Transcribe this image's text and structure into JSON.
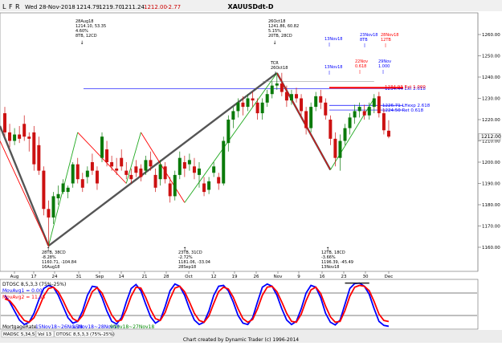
{
  "toolbar": {
    "letters": [
      "L",
      "F",
      "R"
    ],
    "date": "Wed 28-Nov-2018",
    "open": "1214.79",
    "high": "1219.70",
    "low": "1211.24",
    "close": "1212.00",
    "change": "-2.77",
    "title": "XAUUSDdt-D"
  },
  "colors": {
    "up_candle": "#0a7a0a",
    "down_candle": "#cc1111",
    "swing_line": "#555555",
    "red_line": "#ff0000",
    "green_line": "#22aa22",
    "blue_line": "#0000ff",
    "osc_fast": "#0000ff",
    "osc_slow": "#ff0000"
  },
  "chart_data": [
    {
      "type": "candlestick",
      "title": "XAUUSDdt-D",
      "y_axis_labels": [
        "1160.00",
        "1170.00",
        "1180.00",
        "1190.00",
        "1200.00",
        "1210.00",
        "1220.00",
        "1230.00",
        "1240.00",
        "1250.00",
        "1260.00"
      ],
      "x_axis_labels": [
        "Aug",
        "17",
        "24",
        "31",
        "Sep",
        "14",
        "21",
        "28",
        "Oct",
        "12",
        "19",
        "26",
        "Nov",
        "9",
        "16",
        "23",
        "30",
        "Dec"
      ],
      "ylim": [
        1155,
        1265
      ],
      "grid": false,
      "last_price_label": "1212.00",
      "price_levels": [
        {
          "label": "1234.44 Ext 2.618",
          "value": 1234.6,
          "color": "#0000ff"
        },
        {
          "label": "1234.93 Ext 1.000",
          "value": 1235.0,
          "color": "#ff0000"
        },
        {
          "label": "1226.71 LHexp 2.618",
          "value": 1226.7,
          "color": "#0000ff"
        },
        {
          "label": "1224.50 Ret 0.618",
          "value": 1224.5,
          "color": "#0000ff"
        }
      ],
      "swing_points": [
        {
          "label": [
            "28Aug18",
            "1214.10, 53.35",
            "4.60%",
            "8TB, 12CD"
          ],
          "type": "high"
        },
        {
          "label": [
            "26Oct18",
            "1241.86, 60.82",
            "5.15%",
            "20TB, 28CD"
          ],
          "type": "high"
        },
        {
          "label": [
            "28TB, 38CD",
            "-8.28%",
            "1160.71, -104.84",
            "16Aug18"
          ],
          "type": "low"
        },
        {
          "label": [
            "23TB, 31CD",
            "-2.72%",
            "1181.06, -33.04",
            "28Sep18"
          ],
          "type": "low"
        },
        {
          "label": [
            "12TB, 18CD",
            "-3.66%",
            "1196.39, -45.49",
            "13Nov18"
          ],
          "type": "low"
        }
      ],
      "time_labels": [
        {
          "lines": [
            "13Nov18"
          ],
          "color": "#0000ff"
        },
        {
          "lines": [
            "23Nov18",
            "8TB"
          ],
          "color": "#0000ff"
        },
        {
          "lines": [
            "28Nov18",
            "12TB"
          ],
          "color": "#ff0000"
        },
        {
          "lines": [
            "TCR",
            "26Oct18"
          ],
          "color": "#000000"
        },
        {
          "lines": [
            "13Nov18"
          ],
          "color": "#0000ff"
        },
        {
          "lines": [
            "22Nov",
            "0.618"
          ],
          "color": "#ff0000"
        },
        {
          "lines": [
            "29Nov",
            "1.000"
          ],
          "color": "#0000ff"
        }
      ],
      "candles": [
        {
          "o": 1223,
          "h": 1226,
          "l": 1212,
          "c": 1214
        },
        {
          "o": 1214,
          "h": 1218,
          "l": 1207,
          "c": 1210
        },
        {
          "o": 1210,
          "h": 1216,
          "l": 1208,
          "c": 1213
        },
        {
          "o": 1213,
          "h": 1217,
          "l": 1209,
          "c": 1211
        },
        {
          "o": 1218,
          "h": 1222,
          "l": 1210,
          "c": 1212
        },
        {
          "o": 1212,
          "h": 1214,
          "l": 1205,
          "c": 1211
        },
        {
          "o": 1214,
          "h": 1217,
          "l": 1196,
          "c": 1199
        },
        {
          "o": 1208,
          "h": 1212,
          "l": 1194,
          "c": 1196
        },
        {
          "o": 1196,
          "h": 1198,
          "l": 1175,
          "c": 1178
        },
        {
          "o": 1178,
          "h": 1182,
          "l": 1160,
          "c": 1174
        },
        {
          "o": 1174,
          "h": 1186,
          "l": 1171,
          "c": 1184
        },
        {
          "o": 1183,
          "h": 1189,
          "l": 1180,
          "c": 1185
        },
        {
          "o": 1186,
          "h": 1192,
          "l": 1185,
          "c": 1190
        },
        {
          "o": 1186,
          "h": 1189,
          "l": 1183,
          "c": 1188
        },
        {
          "o": 1190,
          "h": 1200,
          "l": 1188,
          "c": 1199
        },
        {
          "o": 1199,
          "h": 1202,
          "l": 1190,
          "c": 1192
        },
        {
          "o": 1192,
          "h": 1195,
          "l": 1186,
          "c": 1188
        },
        {
          "o": 1193,
          "h": 1198,
          "l": 1190,
          "c": 1196
        },
        {
          "o": 1200,
          "h": 1204,
          "l": 1194,
          "c": 1196
        },
        {
          "o": 1196,
          "h": 1198,
          "l": 1187,
          "c": 1190
        },
        {
          "o": 1202,
          "h": 1214,
          "l": 1200,
          "c": 1212
        },
        {
          "o": 1206,
          "h": 1210,
          "l": 1198,
          "c": 1200
        },
        {
          "o": 1200,
          "h": 1203,
          "l": 1196,
          "c": 1198
        },
        {
          "o": 1197,
          "h": 1202,
          "l": 1194,
          "c": 1196
        },
        {
          "o": 1202,
          "h": 1206,
          "l": 1196,
          "c": 1198
        },
        {
          "o": 1196,
          "h": 1200,
          "l": 1192,
          "c": 1194
        },
        {
          "o": 1194,
          "h": 1197,
          "l": 1190,
          "c": 1192
        },
        {
          "o": 1198,
          "h": 1201,
          "l": 1193,
          "c": 1195
        },
        {
          "o": 1197,
          "h": 1199,
          "l": 1191,
          "c": 1193
        },
        {
          "o": 1196,
          "h": 1203,
          "l": 1194,
          "c": 1201
        },
        {
          "o": 1201,
          "h": 1205,
          "l": 1196,
          "c": 1198
        },
        {
          "o": 1194,
          "h": 1197,
          "l": 1186,
          "c": 1188
        },
        {
          "o": 1192,
          "h": 1201,
          "l": 1189,
          "c": 1199
        },
        {
          "o": 1198,
          "h": 1200,
          "l": 1190,
          "c": 1192
        },
        {
          "o": 1190,
          "h": 1193,
          "l": 1181,
          "c": 1184
        },
        {
          "o": 1184,
          "h": 1196,
          "l": 1182,
          "c": 1194
        },
        {
          "o": 1194,
          "h": 1205,
          "l": 1192,
          "c": 1202
        },
        {
          "o": 1200,
          "h": 1203,
          "l": 1193,
          "c": 1197
        },
        {
          "o": 1199,
          "h": 1204,
          "l": 1196,
          "c": 1201
        },
        {
          "o": 1198,
          "h": 1202,
          "l": 1192,
          "c": 1195
        },
        {
          "o": 1194,
          "h": 1200,
          "l": 1188,
          "c": 1197
        },
        {
          "o": 1190,
          "h": 1193,
          "l": 1184,
          "c": 1186
        },
        {
          "o": 1187,
          "h": 1193,
          "l": 1185,
          "c": 1191
        },
        {
          "o": 1195,
          "h": 1200,
          "l": 1193,
          "c": 1198
        },
        {
          "o": 1193,
          "h": 1195,
          "l": 1187,
          "c": 1190
        },
        {
          "o": 1190,
          "h": 1212,
          "l": 1189,
          "c": 1210
        },
        {
          "o": 1209,
          "h": 1222,
          "l": 1205,
          "c": 1220
        },
        {
          "o": 1220,
          "h": 1226,
          "l": 1216,
          "c": 1224
        },
        {
          "o": 1224,
          "h": 1230,
          "l": 1221,
          "c": 1228
        },
        {
          "o": 1228,
          "h": 1231,
          "l": 1222,
          "c": 1226
        },
        {
          "o": 1226,
          "h": 1232,
          "l": 1224,
          "c": 1230
        },
        {
          "o": 1230,
          "h": 1233,
          "l": 1226,
          "c": 1229
        },
        {
          "o": 1228,
          "h": 1230,
          "l": 1220,
          "c": 1223
        },
        {
          "o": 1223,
          "h": 1230,
          "l": 1220,
          "c": 1228
        },
        {
          "o": 1228,
          "h": 1234,
          "l": 1226,
          "c": 1232
        },
        {
          "o": 1232,
          "h": 1238,
          "l": 1230,
          "c": 1236
        },
        {
          "o": 1236,
          "h": 1241,
          "l": 1234,
          "c": 1237
        },
        {
          "o": 1237,
          "h": 1242,
          "l": 1231,
          "c": 1233
        },
        {
          "o": 1233,
          "h": 1236,
          "l": 1226,
          "c": 1229
        },
        {
          "o": 1229,
          "h": 1234,
          "l": 1227,
          "c": 1232
        },
        {
          "o": 1232,
          "h": 1235,
          "l": 1228,
          "c": 1230
        },
        {
          "o": 1230,
          "h": 1232,
          "l": 1222,
          "c": 1224
        },
        {
          "o": 1224,
          "h": 1226,
          "l": 1213,
          "c": 1216
        },
        {
          "o": 1216,
          "h": 1228,
          "l": 1214,
          "c": 1226
        },
        {
          "o": 1226,
          "h": 1233,
          "l": 1224,
          "c": 1231
        },
        {
          "o": 1231,
          "h": 1234,
          "l": 1225,
          "c": 1228
        },
        {
          "o": 1228,
          "h": 1230,
          "l": 1220,
          "c": 1222
        },
        {
          "o": 1220,
          "h": 1222,
          "l": 1208,
          "c": 1211
        },
        {
          "o": 1211,
          "h": 1214,
          "l": 1198,
          "c": 1202
        },
        {
          "o": 1202,
          "h": 1213,
          "l": 1196,
          "c": 1210
        },
        {
          "o": 1210,
          "h": 1218,
          "l": 1208,
          "c": 1216
        },
        {
          "o": 1216,
          "h": 1223,
          "l": 1213,
          "c": 1221
        },
        {
          "o": 1221,
          "h": 1227,
          "l": 1218,
          "c": 1224
        },
        {
          "o": 1224,
          "h": 1228,
          "l": 1221,
          "c": 1226
        },
        {
          "o": 1224,
          "h": 1227,
          "l": 1220,
          "c": 1222
        },
        {
          "o": 1222,
          "h": 1228,
          "l": 1220,
          "c": 1226
        },
        {
          "o": 1226,
          "h": 1232,
          "l": 1223,
          "c": 1230
        },
        {
          "o": 1231,
          "h": 1233,
          "l": 1221,
          "c": 1223
        },
        {
          "o": 1223,
          "h": 1225,
          "l": 1213,
          "c": 1215
        },
        {
          "o": 1214.79,
          "h": 1219.7,
          "l": 1211.24,
          "c": 1212.0
        }
      ]
    },
    {
      "type": "line",
      "title": "DTOSC 8,5,3,3 (75%-25%)",
      "series": [
        {
          "name": "MovAvg1 = 0.00",
          "color": "#0000ff",
          "values": [
            70,
            55,
            35,
            15,
            5,
            10,
            30,
            60,
            85,
            92,
            88,
            70,
            45,
            20,
            8,
            12,
            35,
            70,
            90,
            88,
            65,
            35,
            12,
            6,
            20,
            55,
            85,
            94,
            80,
            50,
            22,
            8,
            15,
            45,
            80,
            95,
            90,
            70,
            40,
            15,
            5,
            10,
            35,
            70,
            90,
            92,
            80,
            55,
            25,
            8,
            5,
            20,
            55,
            88,
            95,
            90,
            70,
            40,
            15,
            5,
            12,
            40,
            75,
            92,
            88,
            65,
            30,
            10,
            4,
            15,
            50,
            85,
            96,
            97,
            90,
            72,
            40,
            12,
            3,
            1
          ]
        },
        {
          "name": "MovAvg2 = 11.55",
          "color": "#ff0000",
          "values": [
            62,
            58,
            45,
            28,
            14,
            10,
            20,
            42,
            68,
            85,
            88,
            78,
            58,
            35,
            18,
            12,
            25,
            52,
            78,
            87,
            75,
            50,
            26,
            12,
            15,
            38,
            68,
            88,
            86,
            65,
            38,
            18,
            14,
            32,
            62,
            86,
            90,
            78,
            55,
            30,
            14,
            10,
            24,
            52,
            78,
            88,
            84,
            66,
            40,
            18,
            10,
            16,
            40,
            70,
            88,
            90,
            78,
            55,
            30,
            12,
            10,
            28,
            58,
            82,
            88,
            74,
            46,
            22,
            10,
            12,
            36,
            68,
            88,
            92,
            90,
            80,
            56,
            28,
            14,
            11.55
          ]
        }
      ],
      "ylim": [
        0,
        100
      ],
      "levels": [
        75,
        25
      ],
      "legend": [
        "DTOSC 8,5,3,3 (75%-25%)",
        "MovAvg1 = 0.00",
        "MovAvg2 = 11.55"
      ]
    }
  ],
  "mortgage_row": {
    "label": "MortgageRate",
    "items": [
      {
        "text": "15Nov18~26Nov18",
        "color": "#0000ff"
      },
      {
        "text": "15Nov18~28Nov18",
        "color": "#0000ff"
      },
      {
        "text": "9Nov18~27Nov18",
        "color": "#008800"
      }
    ]
  },
  "tabs": [
    "MADSC 5,34,5",
    "Vol 13",
    "DTOSC 8,5,3,3 (75%-25%)"
  ],
  "footer": "Chart created by Dynamic Trader  (c)  1996-2014"
}
